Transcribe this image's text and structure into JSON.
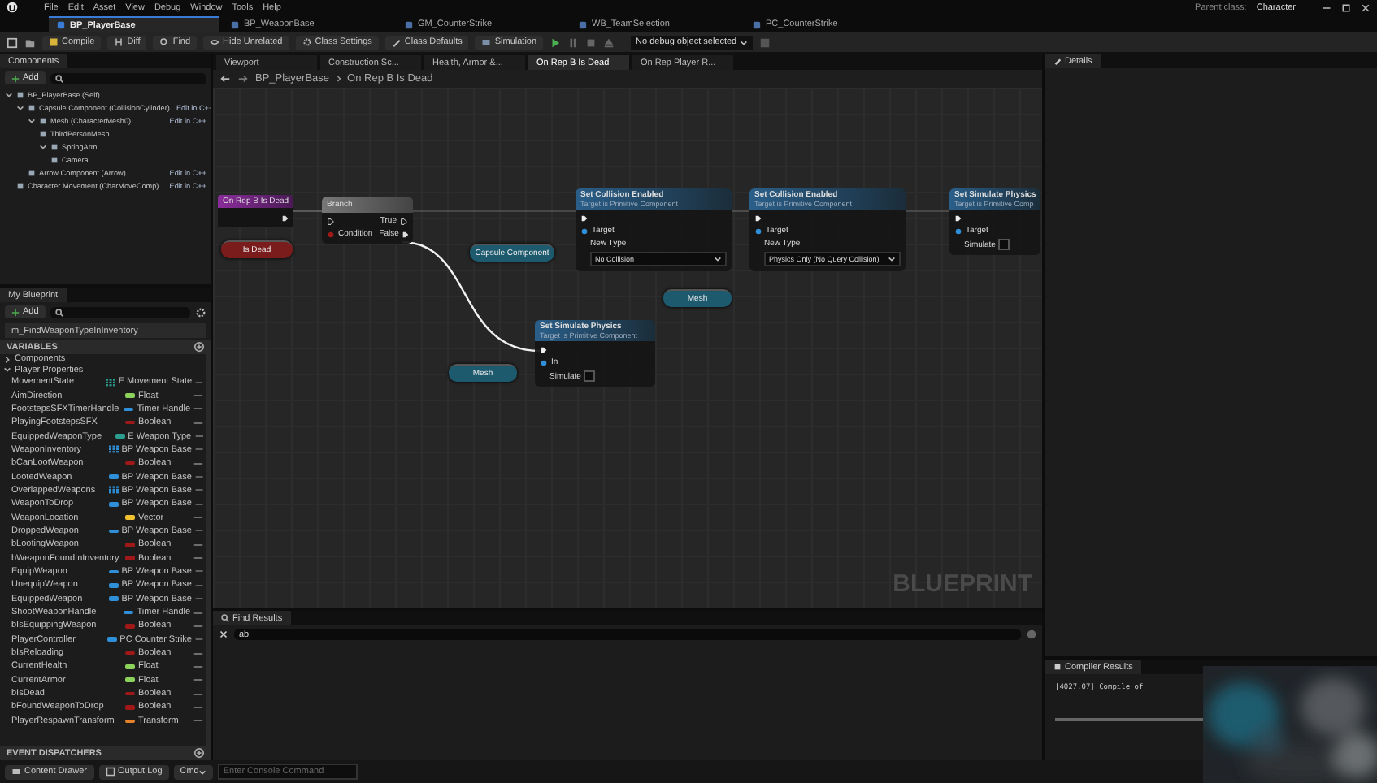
{
  "menu": [
    "File",
    "Edit",
    "Asset",
    "View",
    "Debug",
    "Window",
    "Tools",
    "Help"
  ],
  "parent_class": {
    "label": "Parent class:",
    "value": "Character"
  },
  "asset_tabs": [
    {
      "label": "BP_PlayerBase",
      "selected": true
    },
    {
      "label": "BP_WeaponBase",
      "selected": false
    },
    {
      "label": "GM_CounterStrike",
      "selected": false
    },
    {
      "label": "WB_TeamSelection",
      "selected": false
    },
    {
      "label": "PC_CounterStrike",
      "selected": false
    }
  ],
  "toolbar": {
    "buttons": [
      "Compile",
      "Diff",
      "Find",
      "Hide Unrelated",
      "Class Settings",
      "Class Defaults",
      "Simulation"
    ],
    "debug_select": "No debug object selected"
  },
  "components": {
    "title": "Components",
    "add": "Add",
    "tree": [
      {
        "label": "BP_PlayerBase (Self)",
        "children": [
          {
            "label": "Capsule Component (CollisionCylinder)",
            "edit_link": "Edit in C++",
            "children": [
              {
                "label": "Mesh (CharacterMesh0)",
                "edit_link": "Edit in C++",
                "children": [
                  {
                    "label": "ThirdPersonMesh"
                  },
                  {
                    "label": "SpringArm",
                    "children": [
                      {
                        "label": "Camera"
                      }
                    ]
                  }
                ]
              },
              {
                "label": "Arrow Component (Arrow)",
                "edit_link": "Edit in C++"
              }
            ]
          },
          {
            "label": "Character Movement (CharMoveComp)",
            "edit_link": "Edit in C++"
          }
        ]
      }
    ]
  },
  "my_blueprint": {
    "title": "My Blueprint",
    "add": "Add",
    "functions": [
      "m_FindWeaponTypeInInventory"
    ],
    "variables_header": "VARIABLES",
    "categories": [
      {
        "label": "Components",
        "expanded": false
      },
      {
        "label": "Player Properties",
        "expanded": true,
        "variables": [
          {
            "name": "MovementState",
            "type": "E Movement State",
            "color": "#2a9d8f",
            "array": true
          },
          {
            "name": "AimDirection",
            "type": "Float",
            "color": "#8bd35c",
            "array": false
          },
          {
            "name": "FootstepsSFXTimerHandle",
            "type": "Timer Handle",
            "color": "#2f8fd8",
            "array": false
          },
          {
            "name": "PlayingFootstepsSFX",
            "type": "Boolean",
            "color": "#a01818",
            "array": false
          },
          {
            "name": "EquippedWeaponType",
            "type": "E Weapon Type",
            "color": "#2a9d8f",
            "array": false
          },
          {
            "name": "WeaponInventory",
            "type": "BP Weapon Base",
            "color": "#2f8fd8",
            "array": true
          },
          {
            "name": "bCanLootWeapon",
            "type": "Boolean",
            "color": "#a01818",
            "array": false
          },
          {
            "name": "LootedWeapon",
            "type": "BP Weapon Base",
            "color": "#2f8fd8",
            "array": false
          },
          {
            "name": "OverlappedWeapons",
            "type": "BP Weapon Base",
            "color": "#2f8fd8",
            "array": true
          },
          {
            "name": "WeaponToDrop",
            "type": "BP Weapon Base",
            "color": "#2f8fd8",
            "array": false
          },
          {
            "name": "WeaponLocation",
            "type": "Vector",
            "color": "#f2c230",
            "array": false
          },
          {
            "name": "DroppedWeapon",
            "type": "BP Weapon Base",
            "color": "#2f8fd8",
            "array": false
          },
          {
            "name": "bLootingWeapon",
            "type": "Boolean",
            "color": "#a01818",
            "array": false
          },
          {
            "name": "bWeaponFoundInInventory",
            "type": "Boolean",
            "color": "#a01818",
            "array": false
          },
          {
            "name": "EquipWeapon",
            "type": "BP Weapon Base",
            "color": "#2f8fd8",
            "array": false
          },
          {
            "name": "UnequipWeapon",
            "type": "BP Weapon Base",
            "color": "#2f8fd8",
            "array": false
          },
          {
            "name": "EquippedWeapon",
            "type": "BP Weapon Base",
            "color": "#2f8fd8",
            "array": false
          },
          {
            "name": "ShootWeaponHandle",
            "type": "Timer Handle",
            "color": "#2f8fd8",
            "array": false
          },
          {
            "name": "bIsEquippingWeapon",
            "type": "Boolean",
            "color": "#a01818",
            "array": false
          },
          {
            "name": "PlayerController",
            "type": "PC Counter Strike",
            "color": "#2f8fd8",
            "array": false
          },
          {
            "name": "bIsReloading",
            "type": "Boolean",
            "color": "#a01818",
            "array": false
          },
          {
            "name": "CurrentHealth",
            "type": "Float",
            "color": "#8bd35c",
            "array": false
          },
          {
            "name": "CurrentArmor",
            "type": "Float",
            "color": "#8bd35c",
            "array": false
          },
          {
            "name": "bIsDead",
            "type": "Boolean",
            "color": "#a01818",
            "array": false
          },
          {
            "name": "bFoundWeaponToDrop",
            "type": "Boolean",
            "color": "#a01818",
            "array": false
          },
          {
            "name": "PlayerRespawnTransform",
            "type": "Transform",
            "color": "#e8822a",
            "array": false
          }
        ]
      }
    ],
    "dispatchers_header": "EVENT DISPATCHERS"
  },
  "graph_tabs": [
    {
      "label": "Viewport",
      "selected": false
    },
    {
      "label": "Construction Sc...",
      "selected": false
    },
    {
      "label": "Health, Armor &...",
      "selected": false
    },
    {
      "label": "On Rep B Is Dead",
      "selected": true
    },
    {
      "label": "On Rep Player R...",
      "selected": false
    }
  ],
  "breadcrumb": [
    "BP_PlayerBase",
    "On Rep B Is Dead"
  ],
  "nodes": [
    {
      "kind": "event",
      "title": "On Rep B Is Dead"
    },
    {
      "kind": "getter",
      "title": "Is Dead",
      "color": "#7a1c1c"
    },
    {
      "kind": "branch",
      "title": "Branch",
      "true_label": "True",
      "condition_label": "Condition",
      "false_label": "False"
    },
    {
      "kind": "getter",
      "title": "Capsule Component",
      "color": "#1d5a6e"
    },
    {
      "kind": "function",
      "title": "Set Collision Enabled",
      "subtitle": "Target is Primitive Component",
      "target": "Target",
      "param": {
        "kind": "dropdown",
        "label": "New Type",
        "value": "No Collision"
      }
    },
    {
      "kind": "getter",
      "title": "Mesh",
      "color": "#1d5a6e"
    },
    {
      "kind": "function",
      "title": "Set Collision Enabled",
      "subtitle": "Target is Primitive Component",
      "target": "Target",
      "param": {
        "kind": "dropdown",
        "label": "New Type",
        "value": "Physics Only (No Query Collision)"
      }
    },
    {
      "kind": "function",
      "title": "Set Simulate Physics",
      "subtitle": "Target is Primitive Comp",
      "target": "Target",
      "param": {
        "kind": "checkbox",
        "label": "Simulate",
        "checked": false
      }
    },
    {
      "kind": "getter",
      "title": "Mesh",
      "color": "#1d5a6e"
    },
    {
      "kind": "function",
      "title": "Set Simulate Physics",
      "subtitle": "Target is Primitive Component",
      "target": "In",
      "param": {
        "kind": "checkbox",
        "label": "Simulate",
        "checked": false
      }
    }
  ],
  "graph_label": "BLUEPRINT",
  "find_results": {
    "title": "Find Results",
    "value": "abl"
  },
  "details": {
    "title": "Details"
  },
  "compiler_results": {
    "title": "Compiler Results",
    "lines": [
      "[4027.07] Compile of"
    ]
  },
  "bottom_bar": {
    "content_drawer": "Content Drawer",
    "output_log": "Output Log",
    "cmd": "Cmd",
    "console_placeholder": "Enter Console Command"
  }
}
